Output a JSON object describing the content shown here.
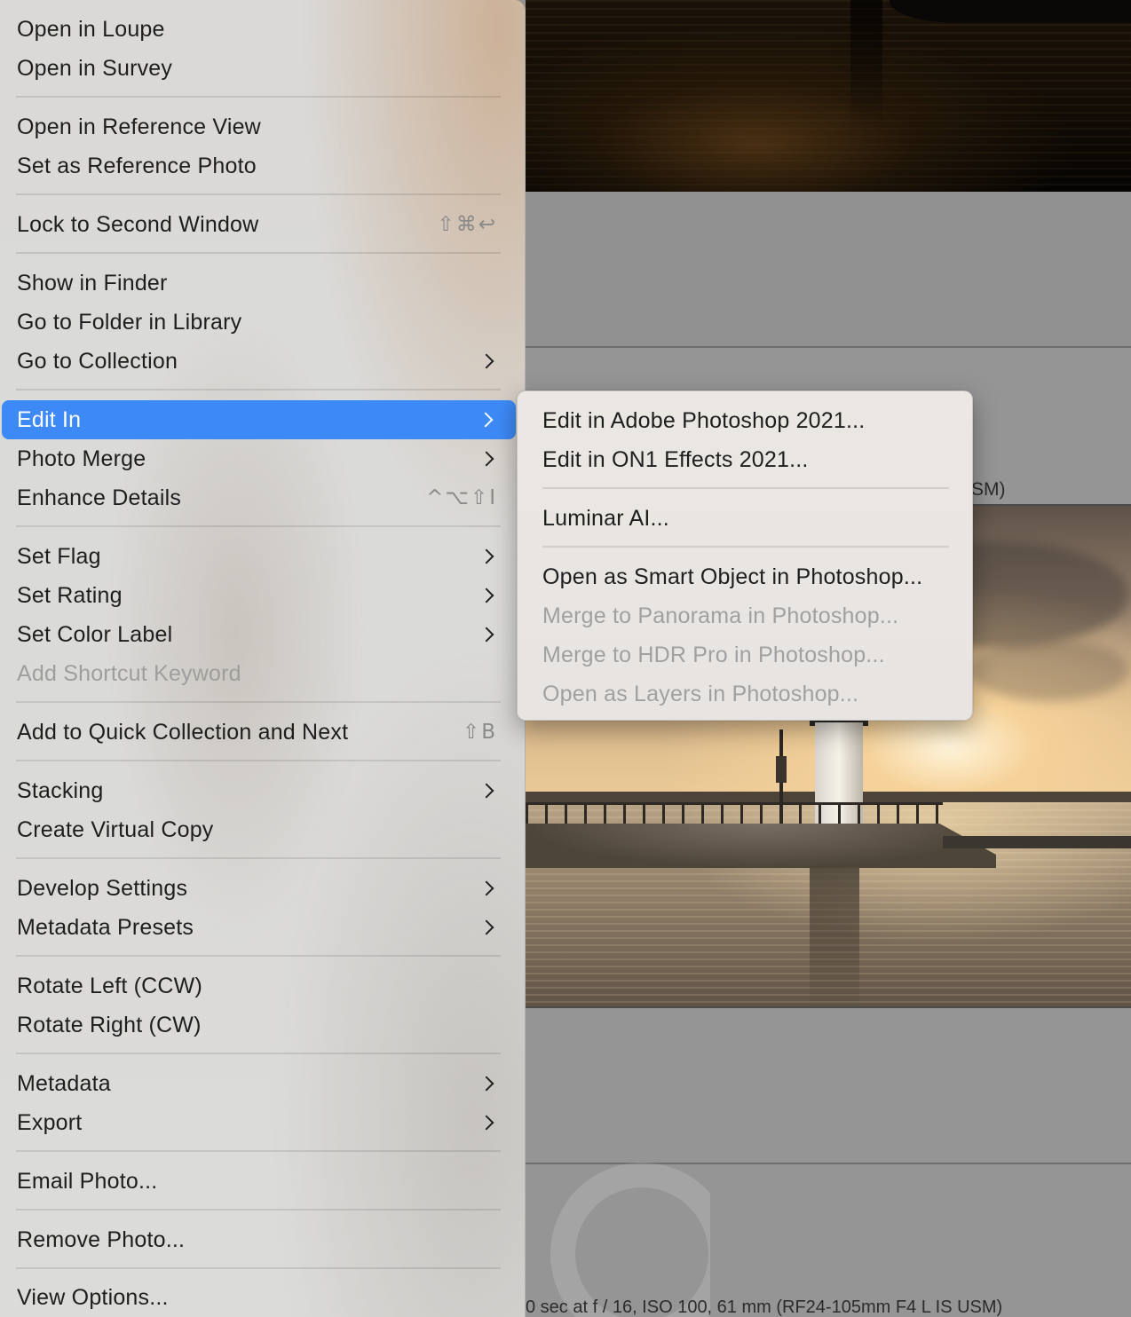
{
  "menu": {
    "items": [
      {
        "label": "Open in Loupe"
      },
      {
        "label": "Open in Survey"
      },
      {
        "label": "Open in Reference View"
      },
      {
        "label": "Set as Reference Photo"
      },
      {
        "label": "Lock to Second Window",
        "shortcut": "⇧⌘↩"
      },
      {
        "label": "Show in Finder"
      },
      {
        "label": "Go to Folder in Library"
      },
      {
        "label": "Go to Collection",
        "submenu": true
      },
      {
        "label": "Edit In",
        "submenu": true,
        "selected": true
      },
      {
        "label": "Photo Merge",
        "submenu": true
      },
      {
        "label": "Enhance Details",
        "shortcut": "^⌥⇧I"
      },
      {
        "label": "Set Flag",
        "submenu": true
      },
      {
        "label": "Set Rating",
        "submenu": true
      },
      {
        "label": "Set Color Label",
        "submenu": true
      },
      {
        "label": "Add Shortcut Keyword",
        "disabled": true
      },
      {
        "label": "Add to Quick Collection and Next",
        "shortcut": "⇧B"
      },
      {
        "label": "Stacking",
        "submenu": true
      },
      {
        "label": "Create Virtual Copy"
      },
      {
        "label": "Develop Settings",
        "submenu": true
      },
      {
        "label": "Metadata Presets",
        "submenu": true
      },
      {
        "label": "Rotate Left (CCW)"
      },
      {
        "label": "Rotate Right (CW)"
      },
      {
        "label": "Metadata",
        "submenu": true
      },
      {
        "label": "Export",
        "submenu": true
      },
      {
        "label": "Email Photo..."
      },
      {
        "label": "Remove Photo..."
      },
      {
        "label": "View Options..."
      }
    ]
  },
  "submenu": {
    "items": [
      {
        "label": "Edit in Adobe Photoshop 2021..."
      },
      {
        "label": "Edit in ON1 Effects 2021..."
      },
      {
        "label": "Luminar AI..."
      },
      {
        "label": "Open as Smart Object in Photoshop..."
      },
      {
        "label": "Merge to Panorama in Photoshop...",
        "disabled": true
      },
      {
        "label": "Merge to HDR Pro in Photoshop...",
        "disabled": true
      },
      {
        "label": "Open as Layers in Photoshop...",
        "disabled": true
      }
    ]
  },
  "background": {
    "partial_lens_text": "SM)",
    "exif_caption": "0 sec at f / 16, ISO 100, 61 mm (RF24-105mm F4 L IS USM)"
  },
  "colors": {
    "selection": "#3d8af7",
    "menu_bg": "#dbdbd9",
    "disabled_text": "#9e9e9e"
  },
  "icons": {
    "submenu_indicator": "chevron-right-icon"
  }
}
